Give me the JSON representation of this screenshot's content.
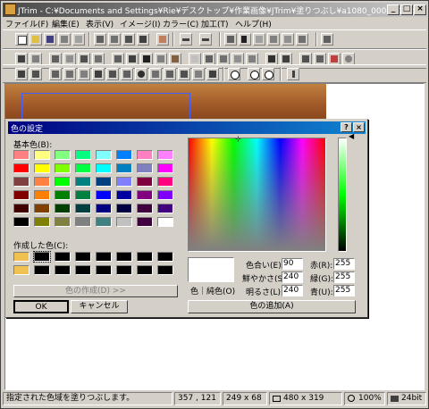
{
  "window": {
    "title": "JTrim - C:¥Documents and Settings¥Rie¥デスクトップ¥作業画像¥JTrim¥塗りつぶし¥a1080_000130.jpg",
    "controls": {
      "minimize": "_",
      "maximize": "□",
      "close": "×"
    }
  },
  "menu": [
    "ファイル(F)",
    "編集(E)",
    "表示(V)",
    "イメージ(I)",
    "カラー(C)",
    "加工(T)",
    "ヘルプ(H)"
  ],
  "statusbar": {
    "message": "指定された色域を塗りつぶします。",
    "cursor": "357 , 121",
    "selection": "249 x 68",
    "image_size": "480 x 319",
    "zoom": "100%",
    "depth": "24bit"
  },
  "dialog": {
    "title": "色の設定",
    "help": "?",
    "close": "×",
    "basic_colors_label": "基本色(B):",
    "basic_colors": [
      "#ff8080",
      "#ffff80",
      "#80ff80",
      "#00ff80",
      "#80ffff",
      "#0080ff",
      "#ff80c0",
      "#ff80ff",
      "#ff0000",
      "#ffff00",
      "#80ff00",
      "#00ff40",
      "#00ffff",
      "#0080c0",
      "#8080c0",
      "#ff00ff",
      "#804040",
      "#ff8040",
      "#00ff00",
      "#008080",
      "#004080",
      "#8080ff",
      "#800040",
      "#ff0080",
      "#800000",
      "#ff8000",
      "#008000",
      "#008040",
      "#0000ff",
      "#0000a0",
      "#800080",
      "#8000ff",
      "#400000",
      "#804000",
      "#004000",
      "#004040",
      "#000080",
      "#000040",
      "#400040",
      "#400080",
      "#000000",
      "#808000",
      "#808040",
      "#808080",
      "#408080",
      "#c0c0c0",
      "#400040",
      "#ffffff"
    ],
    "custom_colors_label": "作成した色(C):",
    "custom_colors": [
      "#f0c050",
      "#000000",
      "#000000",
      "#000000",
      "#000000",
      "#000000",
      "#000000",
      "#000000",
      "#f0c050",
      "#000000",
      "#000000",
      "#000000",
      "#000000",
      "#000000",
      "#000000",
      "#000000"
    ],
    "define_custom": "色の作成(D) >>",
    "ok": "OK",
    "cancel": "キャンセル",
    "color_solid_label": "色｜純色(O)",
    "hue_label": "色合い(E):",
    "hue": "90",
    "sat_label": "鮮やかさ(S):",
    "sat": "240",
    "lum_label": "明るさ(L):",
    "lum": "240",
    "red_label": "赤(R):",
    "red": "255",
    "green_label": "緑(G):",
    "green": "255",
    "blue_label": "青(U):",
    "blue": "255",
    "add_custom": "色の追加(A)"
  }
}
